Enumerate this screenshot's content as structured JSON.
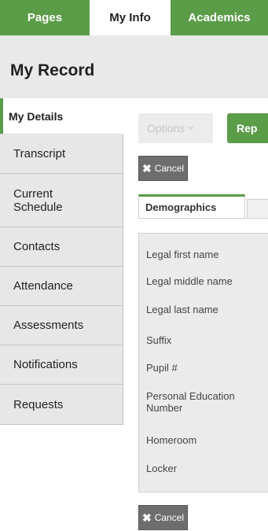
{
  "topnav": {
    "tabs": [
      {
        "label": "Pages"
      },
      {
        "label": "My Info"
      },
      {
        "label": "Academics"
      }
    ]
  },
  "header": {
    "title": "My Record"
  },
  "sidebar": {
    "items": [
      {
        "label": "My Details"
      },
      {
        "label": "Transcript"
      },
      {
        "label": "Current Schedule"
      },
      {
        "label": "Contacts"
      },
      {
        "label": "Attendance"
      },
      {
        "label": "Assessments"
      },
      {
        "label": "Notifications"
      },
      {
        "label": "Requests"
      }
    ]
  },
  "toolbar": {
    "options_label": "Options",
    "rep_label": "Rep",
    "cancel_label": "Cancel"
  },
  "subtabs": {
    "active_label": "Demographics"
  },
  "fields": [
    "Legal first name",
    "Legal middle name",
    "Legal last name",
    "Suffix",
    "Pupil #",
    "Personal Education Number",
    "Homeroom",
    "Locker"
  ],
  "colors": {
    "accent": "#5b9c48",
    "header_bg": "#e9e9e9",
    "sidebar_bg": "#e7e7e7"
  }
}
